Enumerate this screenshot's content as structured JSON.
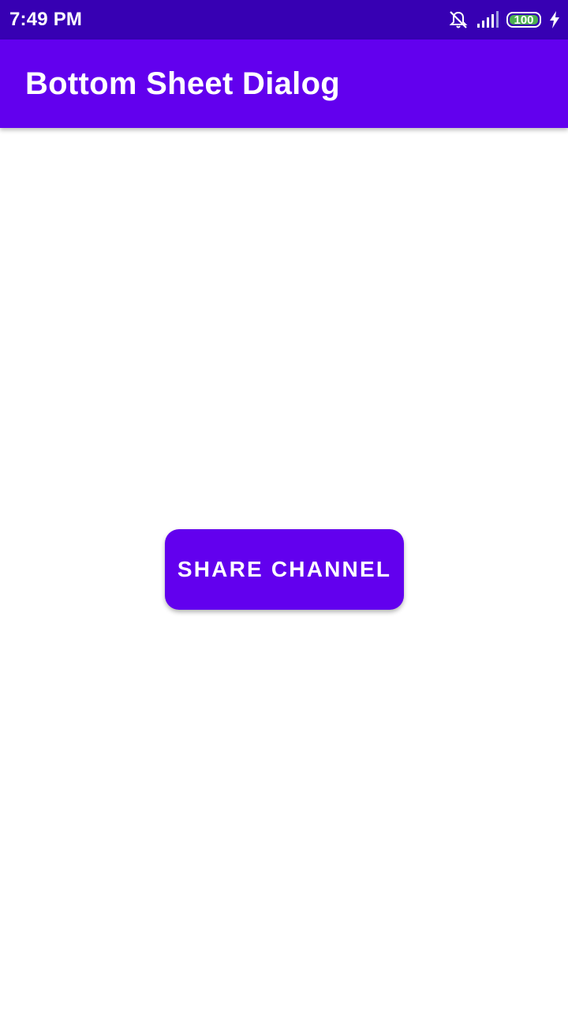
{
  "status_bar": {
    "time": "7:49 PM",
    "battery_level": "100",
    "icons": [
      "notifications-off-icon",
      "signal-icon",
      "battery-icon",
      "charging-icon"
    ],
    "battery_color": "#4caf50"
  },
  "app_bar": {
    "title": "Bottom Sheet Dialog"
  },
  "main": {
    "share_button_label": "SHARE CHANNEL"
  },
  "colors": {
    "primary": "#6200ee",
    "primary_dark": "#3700b3",
    "background": "#ffffff"
  }
}
